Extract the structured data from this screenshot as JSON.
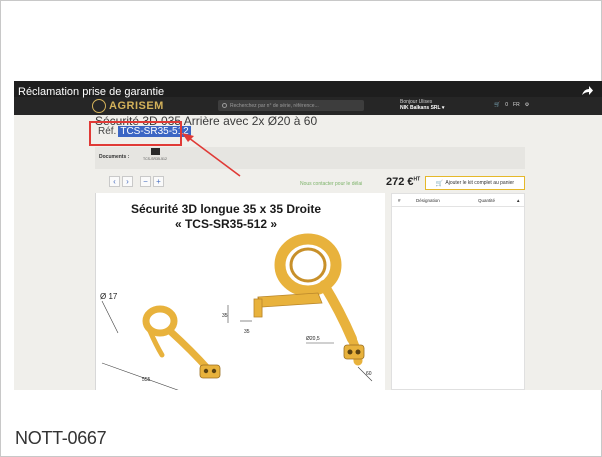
{
  "video": {
    "title": "Réclamation prise de garantie"
  },
  "site": {
    "logo_text": "AGRISEM",
    "search_placeholder": "Recherchez par n° de série, référence...",
    "account_label": "Bonjour Ulises",
    "account_name": "NIK Balkans SRL ▾",
    "cart_count": "0",
    "lang": "FR"
  },
  "product": {
    "title": "Sécurité 3D 035 Arrière avec 2x Ø20 à 60",
    "ref_label": "Réf.",
    "ref_code": "TCS-SR35-512"
  },
  "documents": {
    "label": "Documents :",
    "caption": "TCS-SR35-512"
  },
  "toolbar": {
    "prev": "‹",
    "next": "›",
    "zoom_out": "−",
    "zoom_in": "+",
    "contact_text": "Nous contacter pour le délai",
    "price": "272 €",
    "price_suffix": "HT",
    "add_kit_label": "Ajouter le kit complet au panier"
  },
  "drawing": {
    "title_line1": "Sécurité 3D longue 35 x 35 Droite",
    "title_line2": "« TCS-SR35-512 »",
    "dim_diameter": "Ø 17",
    "dim_35a": "35",
    "dim_35b": "35",
    "dim_205": "Ø20,5",
    "dim_555": "555",
    "dim_60": "60"
  },
  "parts_table": {
    "col_hash": "#",
    "col_designation": "Désignation",
    "col_quantity": "Quantité"
  },
  "caption": "NOTT-0667",
  "colors": {
    "highlight_box": "#e03a36",
    "selection": "#3c66c4",
    "spring_gold": "#e8b23c",
    "add_kit_border": "#e5b82a"
  }
}
